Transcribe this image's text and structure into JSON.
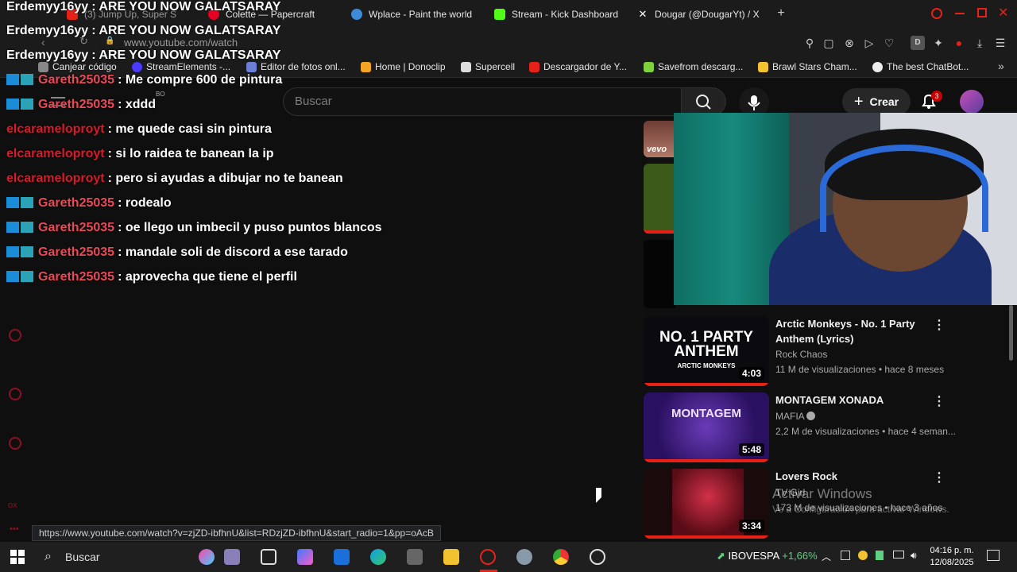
{
  "browser": {
    "tabs": [
      {
        "label": "(3) Jump Up, Super S",
        "active": true
      },
      {
        "label": "Colette — Papercraft"
      },
      {
        "label": "Wplace - Paint the world"
      },
      {
        "label": "Stream - Kick Dashboard"
      },
      {
        "label": "Dougar (@DougarYt) / X"
      }
    ],
    "new_tab_icon": "plus-icon",
    "url": "www.youtube.com/watch",
    "bookmarks": [
      "Canjear código",
      "StreamElements -...",
      "Editor de fotos onl...",
      "Home | Donoclip",
      "Supercell",
      "Descargador de Y...",
      "Savefrom descarg...",
      "Brawl Stars Cham...",
      "The best ChatBot..."
    ]
  },
  "youtube": {
    "logo_suffix": "BO",
    "search_placeholder": "Buscar",
    "create_label": "Crear",
    "notifications_count": "3"
  },
  "chat": [
    {
      "user": "Erdemyy16yy",
      "text": ": ARE YOU NOW GALATSARAY",
      "style": "white"
    },
    {
      "user": "Erdemyy16yy",
      "text": ": ARE YOU NOW GALATSARAY",
      "style": "white"
    },
    {
      "user": "Erdemyy16yy",
      "text": ": ARE YOU NOW GALATSARAY",
      "style": "white"
    },
    {
      "user": "Gareth25035",
      "text": ": Me compre 600 de pintura",
      "style": "badge"
    },
    {
      "user": "Gareth25035",
      "text": ": xddd",
      "style": "badge"
    },
    {
      "user": "elcarameloproyt",
      "text": ": me quede casi sin pintura",
      "style": "plain"
    },
    {
      "user": "elcarameloproyt",
      "text": ": si lo raidea te banean la ip",
      "style": "plain"
    },
    {
      "user": "elcarameloproyt",
      "text": ": pero si ayudas a dibujar no te banean",
      "style": "plain"
    },
    {
      "user": "Gareth25035",
      "text": ": rodealo",
      "style": "badge"
    },
    {
      "user": "Gareth25035",
      "text": ": oe llego un imbecil y puso puntos blancos",
      "style": "badge"
    },
    {
      "user": "Gareth25035",
      "text": ": mandale soli de discord a ese tarado",
      "style": "badge"
    },
    {
      "user": "Gareth25035",
      "text": ": aprovecha que tiene el perfil",
      "style": "badge"
    }
  ],
  "recommendations": [
    {
      "thumb_text": "NO. 1 PARTY ANTHEM",
      "thumb_sub": "ARCTIC MONKEYS",
      "duration": "4:03",
      "title": "Arctic Monkeys - No. 1 Party Anthem (Lyrics)",
      "channel": "Rock Chaos",
      "meta": "11 M de visualizaciones • hace 8 meses"
    },
    {
      "thumb_text": "MONTAGEM",
      "thumb_sub": "",
      "duration": "5:48",
      "title": "MONTAGEM XONADA",
      "channel": "MAFIA",
      "meta": "2,2 M de visualizaciones • hace 4 seman..."
    },
    {
      "thumb_text": "",
      "thumb_sub": "",
      "duration": "3:34",
      "title": "Lovers Rock",
      "channel": "TV Girl",
      "meta": "173 M de visualizaciones • hace 3 años"
    }
  ],
  "thumb_label_vevo": "vevo",
  "status_url": "https://www.youtube.com/watch?v=zjZD-ibfhnU&list=RDzjZD-ibfhnU&start_radio=1&pp=oAcB",
  "watermark": {
    "line1": "Activar Windows",
    "line2": "Ve a Configuración para activar Windows."
  },
  "taskbar": {
    "search_label": "Buscar",
    "stock_name": "IBOVESPA",
    "stock_change": "+1,66%",
    "time": "04:16 p. m.",
    "date": "12/08/2025"
  },
  "colors": {
    "accent": "#e62117",
    "username": "#e84a57",
    "bg": "#0f0f0f"
  }
}
